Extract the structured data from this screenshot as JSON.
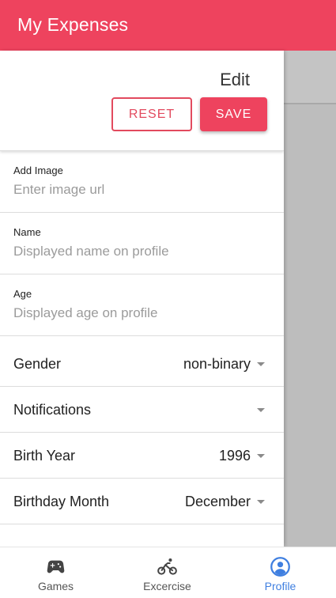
{
  "header": {
    "title": "My Expenses"
  },
  "edit": {
    "title": "Edit",
    "reset_label": "RESET",
    "save_label": "SAVE"
  },
  "fields": [
    {
      "label": "Add Image",
      "placeholder": "Enter image url",
      "value": ""
    },
    {
      "label": "Name",
      "placeholder": "Displayed name on profile",
      "value": ""
    },
    {
      "label": "Age",
      "placeholder": "Displayed age on profile",
      "value": ""
    }
  ],
  "selects": [
    {
      "label": "Gender",
      "value": "non-binary"
    },
    {
      "label": "Notifications",
      "value": ""
    },
    {
      "label": "Birth Year",
      "value": "1996"
    },
    {
      "label": "Birthday Month",
      "value": "December"
    }
  ],
  "bottom_nav": {
    "active_color": "#3f7fe0",
    "items": [
      {
        "label": "Games",
        "icon": "gamepad-icon"
      },
      {
        "label": "Excercise",
        "icon": "bicycle-icon"
      },
      {
        "label": "Profile",
        "icon": "account-circle-icon",
        "active": true
      }
    ]
  },
  "colors": {
    "accent": "#ee435e",
    "overlay": "#bdbdbd"
  }
}
